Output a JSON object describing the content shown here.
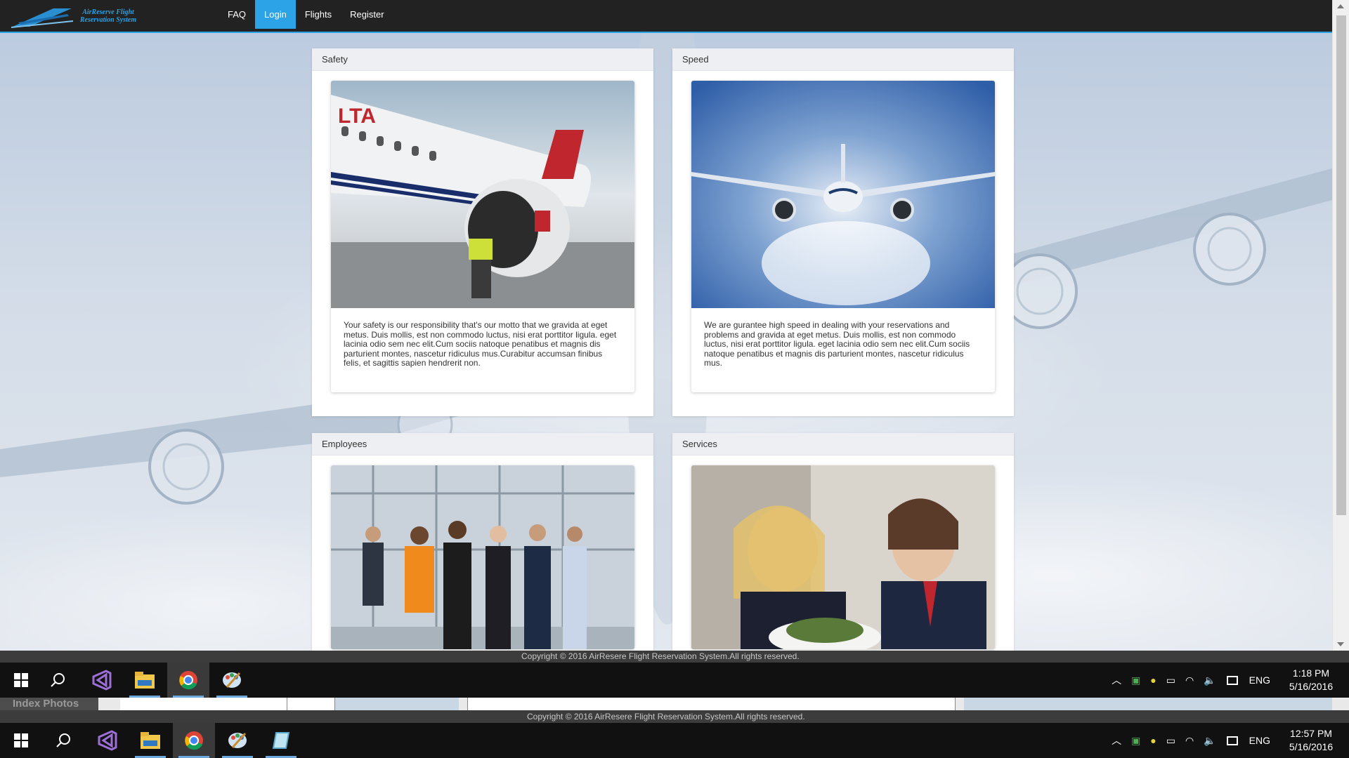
{
  "brand": {
    "name": "AirReserve Flight Reservation System"
  },
  "nav": {
    "items": [
      {
        "label": "FAQ",
        "active": false
      },
      {
        "label": "Login",
        "active": true
      },
      {
        "label": "Flights",
        "active": false
      },
      {
        "label": "Register",
        "active": false
      }
    ]
  },
  "panels": [
    {
      "title": "Safety",
      "photo": "airliner-engine-ground-crew-photo",
      "text": "Your safety is our responsibility that's our motto that we gravida at eget metus. Duis mollis, est non commodo luctus, nisi erat porttitor ligula. eget lacinia odio sem nec elit.Cum sociis natoque penatibus et magnis dis parturient montes, nascetur ridiculus mus.Curabitur accumsan finibus felis, et sagittis sapien hendrerit non."
    },
    {
      "title": "Speed",
      "photo": "airliner-in-flight-motion-blur-photo",
      "text": "We are gurantee high speed in dealing with your reservations and problems and gravida at eget metus. Duis mollis, est non commodo luctus, nisi erat porttitor ligula. eget lacinia odio sem nec elit.Cum sociis natoque penatibus et magnis dis parturient montes, nascetur ridiculus mus."
    },
    {
      "title": "Employees",
      "photo": "airline-crew-group-photo"
    },
    {
      "title": "Services",
      "photo": "flight-attendant-serving-passenger-photo"
    }
  ],
  "footer": {
    "copyright_front": "Copyright © 2016 AirResere Flight Reservation System.All rights reserved.",
    "copyright_back": "Copyright © 2016 AirResere Flight Reservation System.All rights reserved."
  },
  "background_window": {
    "label": "Index Photos"
  },
  "taskbar_front": {
    "apps": [
      "windows-start-icon",
      "search-icon",
      "visual-studio-icon",
      "file-explorer-icon",
      "chrome-icon",
      "paint-icon"
    ],
    "language": "ENG",
    "time": "1:18 PM",
    "date": "5/16/2016"
  },
  "taskbar_back": {
    "apps": [
      "windows-start-icon",
      "search-icon",
      "visual-studio-icon",
      "file-explorer-icon",
      "chrome-icon",
      "paint-icon",
      "notepad-icon"
    ],
    "language": "ENG",
    "time": "12:57 PM",
    "date": "5/16/2016"
  },
  "colors": {
    "navbar": "#222222",
    "accent": "#2ba3e6",
    "panel_heading": "#edeff2",
    "footer": "#3c3c3c",
    "taskbar": "#111111"
  }
}
